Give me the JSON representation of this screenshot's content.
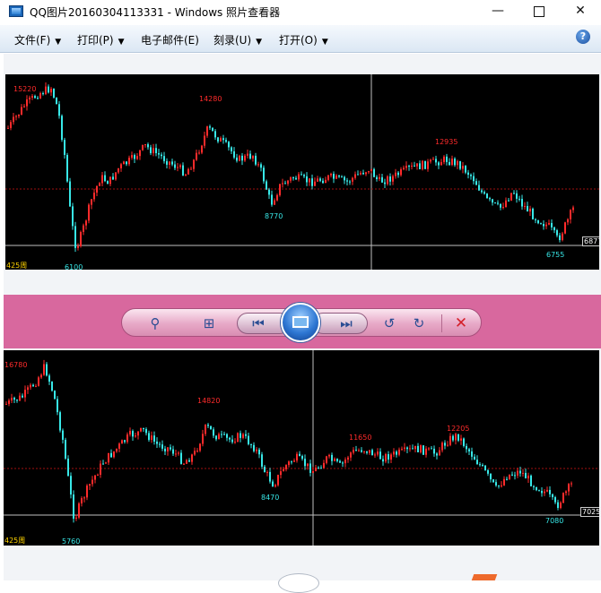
{
  "window": {
    "title": "QQ图片20160304113331 - Windows 照片查看器",
    "minimize_glyph": "—",
    "close_glyph": "✕"
  },
  "menu": {
    "items": [
      {
        "label": "文件(F)",
        "has_dropdown": true
      },
      {
        "label": "打印(P)",
        "has_dropdown": true
      },
      {
        "label": "电子邮件(E)",
        "has_dropdown": false
      },
      {
        "label": "刻录(U)",
        "has_dropdown": true
      },
      {
        "label": "打开(O)",
        "has_dropdown": true
      }
    ],
    "dropdown_glyph": "▼",
    "help_glyph": "?"
  },
  "chart_top": {
    "labels": {
      "high_left": "15220",
      "peak": "14280",
      "low_mid": "8770",
      "peak_right": "12935",
      "low_right": "6755",
      "low_left": "6100",
      "side_value": "6877",
      "period": "425周"
    }
  },
  "chart_bottom": {
    "labels": {
      "high_left": "16780",
      "peak": "14820",
      "low_mid": "8470",
      "mid_high": "11650",
      "peak_right": "12205",
      "low_right": "7080",
      "low_left": "5760",
      "side_value": "7025",
      "period": "425周"
    }
  },
  "controls": {
    "zoom_glyph": "⚲",
    "fit_glyph": "⊞",
    "previous_glyph": "⏮",
    "next_glyph": "⏭",
    "rotate_ccw_glyph": "↺",
    "rotate_cw_glyph": "↻",
    "delete_glyph": "✕"
  },
  "colors": {
    "up_candle": "#ff2b2b",
    "down_candle": "#38e8e8",
    "chart_background": "#000000",
    "control_band": "#d8689e"
  }
}
